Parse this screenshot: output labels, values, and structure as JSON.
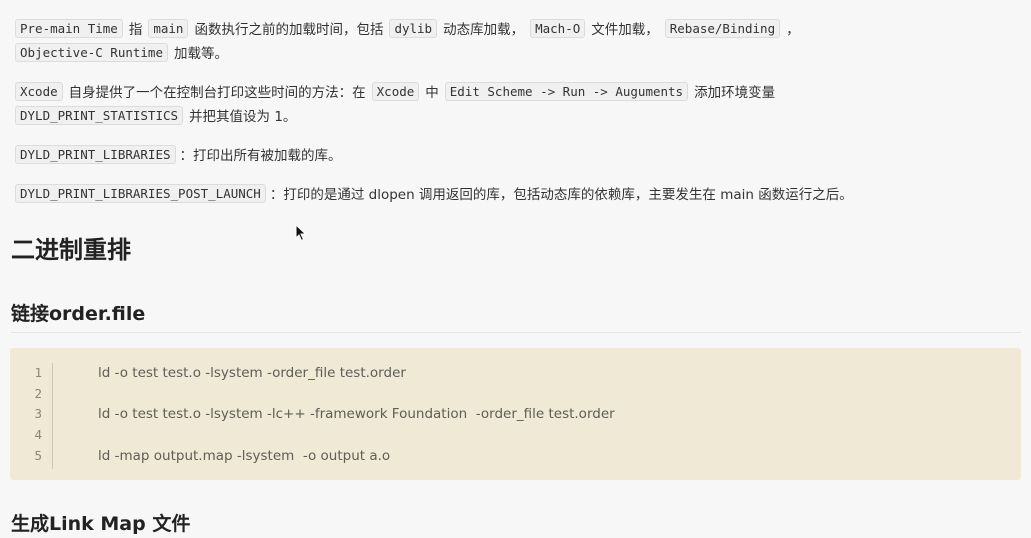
{
  "paragraphs": {
    "p1": {
      "code1": "Pre-main Time",
      "t1": "指",
      "code2": "main",
      "t2": "函数执行之前的加载时间，包括",
      "code3": "dylib",
      "t3": "动态库加载，",
      "code4": "Mach-O",
      "t4": "文件加载，",
      "code5": "Rebase/Binding",
      "t5": "，",
      "code6": "Objective-C Runtime",
      "t6": "加载等。"
    },
    "p2": {
      "code1": "Xcode",
      "t1": "自身提供了一个在控制台打印这些时间的方法：在",
      "code2": "Xcode",
      "t2": "中",
      "code3": "Edit Scheme -> Run -> Auguments",
      "t3": "添加环境变量",
      "code4": "DYLD_PRINT_STATISTICS",
      "t4": "并把其值设为 1。"
    },
    "p3": {
      "code1": "DYLD_PRINT_LIBRARIES",
      "t1": "：打印出所有被加载的库。"
    },
    "p4": {
      "code1": "DYLD_PRINT_LIBRARIES_POST_LAUNCH",
      "t1": "：打印的是通过 dlopen 调用返回的库，包括动态库的依赖库，主要发生在 main 函数运行之后。"
    }
  },
  "heading1": "二进制重排",
  "heading2": "链接order.file",
  "code_block": {
    "line_numbers": [
      "1",
      "2",
      "3",
      "4",
      "5"
    ],
    "lines": [
      "ld -o test test.o -lsystem -order_file test.order",
      "",
      "ld -o test test.o -lsystem -lc++ -framework Foundation  -order_file test.order",
      "",
      "ld -map output.map -lsystem  -o output a.o"
    ]
  },
  "heading3": "生成Link Map 文件",
  "colors": {
    "background": "#f7f7f7",
    "code_block_bg": "#efe9d6",
    "inline_code_bg": "#f0f0f0"
  },
  "icons": {
    "cursor": "mouse-pointer-icon"
  }
}
